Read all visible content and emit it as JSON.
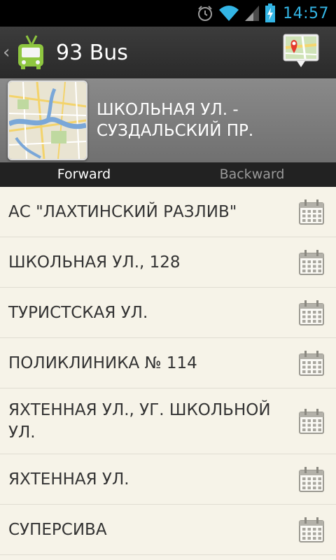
{
  "status_bar": {
    "time": "14:57",
    "icons": [
      "alarm-icon",
      "wifi-icon",
      "signal-icon",
      "battery-charging-icon"
    ],
    "time_color": "#33b5e5"
  },
  "action_bar": {
    "title": "93 Bus",
    "up_icon": "chevron-left-icon",
    "app_icon": "trolleybus-icon",
    "map_button_icon": "map-pin-icon"
  },
  "route": {
    "name": "ШКОЛЬНАЯ УЛ. - СУЗДАЛЬСКИЙ ПР.",
    "thumbnail": "city-map-thumbnail"
  },
  "tabs": [
    {
      "label": "Forward",
      "active": true
    },
    {
      "label": "Backward",
      "active": false
    }
  ],
  "stops": [
    {
      "name": "АС \"ЛАХТИНСКИЙ РАЗЛИВ\""
    },
    {
      "name": "ШКОЛЬНАЯ УЛ., 128"
    },
    {
      "name": "ТУРИСТСКАЯ УЛ."
    },
    {
      "name": "ПОЛИКЛИНИКА № 114"
    },
    {
      "name": "ЯХТЕННАЯ УЛ., УГ. ШКОЛЬНОЙ УЛ."
    },
    {
      "name": "ЯХТЕННАЯ УЛ."
    },
    {
      "name": "СУПЕРСИВА"
    }
  ],
  "colors": {
    "accent": "#33b5e5",
    "app_green": "#8ec63f",
    "list_background": "#f6f3e8"
  }
}
